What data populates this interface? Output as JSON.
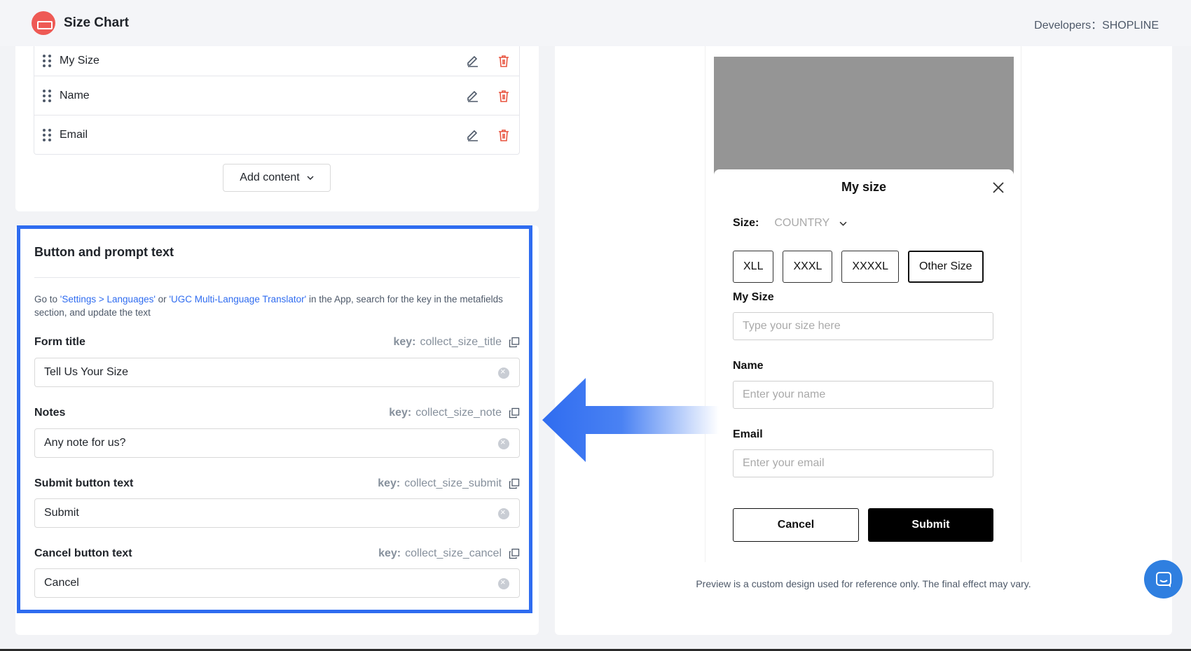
{
  "header": {
    "title": "Size Chart",
    "developer_label": "Developers：",
    "developer_name": "SHOPLINE"
  },
  "content_list": {
    "items": [
      {
        "label": "My Size"
      },
      {
        "label": "Name"
      },
      {
        "label": "Email"
      }
    ],
    "add_button": "Add content"
  },
  "prompt_section": {
    "title": "Button and prompt text",
    "desc_prefix": "Go to ",
    "desc_link1": "'Settings > Languages'",
    "desc_mid": " or ",
    "desc_link2": "'UGC Multi-Language Translator'",
    "desc_suffix": " in the App, search for the key in the metafields section, and update the text",
    "key_label": "key:",
    "fields": [
      {
        "label": "Form title",
        "key": "collect_size_title",
        "value": "Tell Us Your Size"
      },
      {
        "label": "Notes",
        "key": "collect_size_note",
        "value": "Any note for us?"
      },
      {
        "label": "Submit button text",
        "key": "collect_size_submit",
        "value": "Submit"
      },
      {
        "label": "Cancel button text",
        "key": "collect_size_cancel",
        "value": "Cancel"
      }
    ]
  },
  "preview": {
    "title": "My size",
    "size_label": "Size:",
    "country_placeholder": "COUNTRY",
    "chips": [
      "XLL",
      "XXXL",
      "XXXXL",
      "Other Size"
    ],
    "my_size_label": "My Size",
    "my_size_placeholder": "Type your size here",
    "name_label": "Name",
    "name_placeholder": "Enter your name",
    "email_label": "Email",
    "email_placeholder": "Enter your email",
    "cancel": "Cancel",
    "submit": "Submit",
    "note": "Preview is a custom design used for reference only. The final effect may vary."
  },
  "colors": {
    "accent": "#2f6cf0",
    "delete": "#e8543f",
    "logo": "#ee5a55",
    "chat": "#2f7fe0"
  }
}
